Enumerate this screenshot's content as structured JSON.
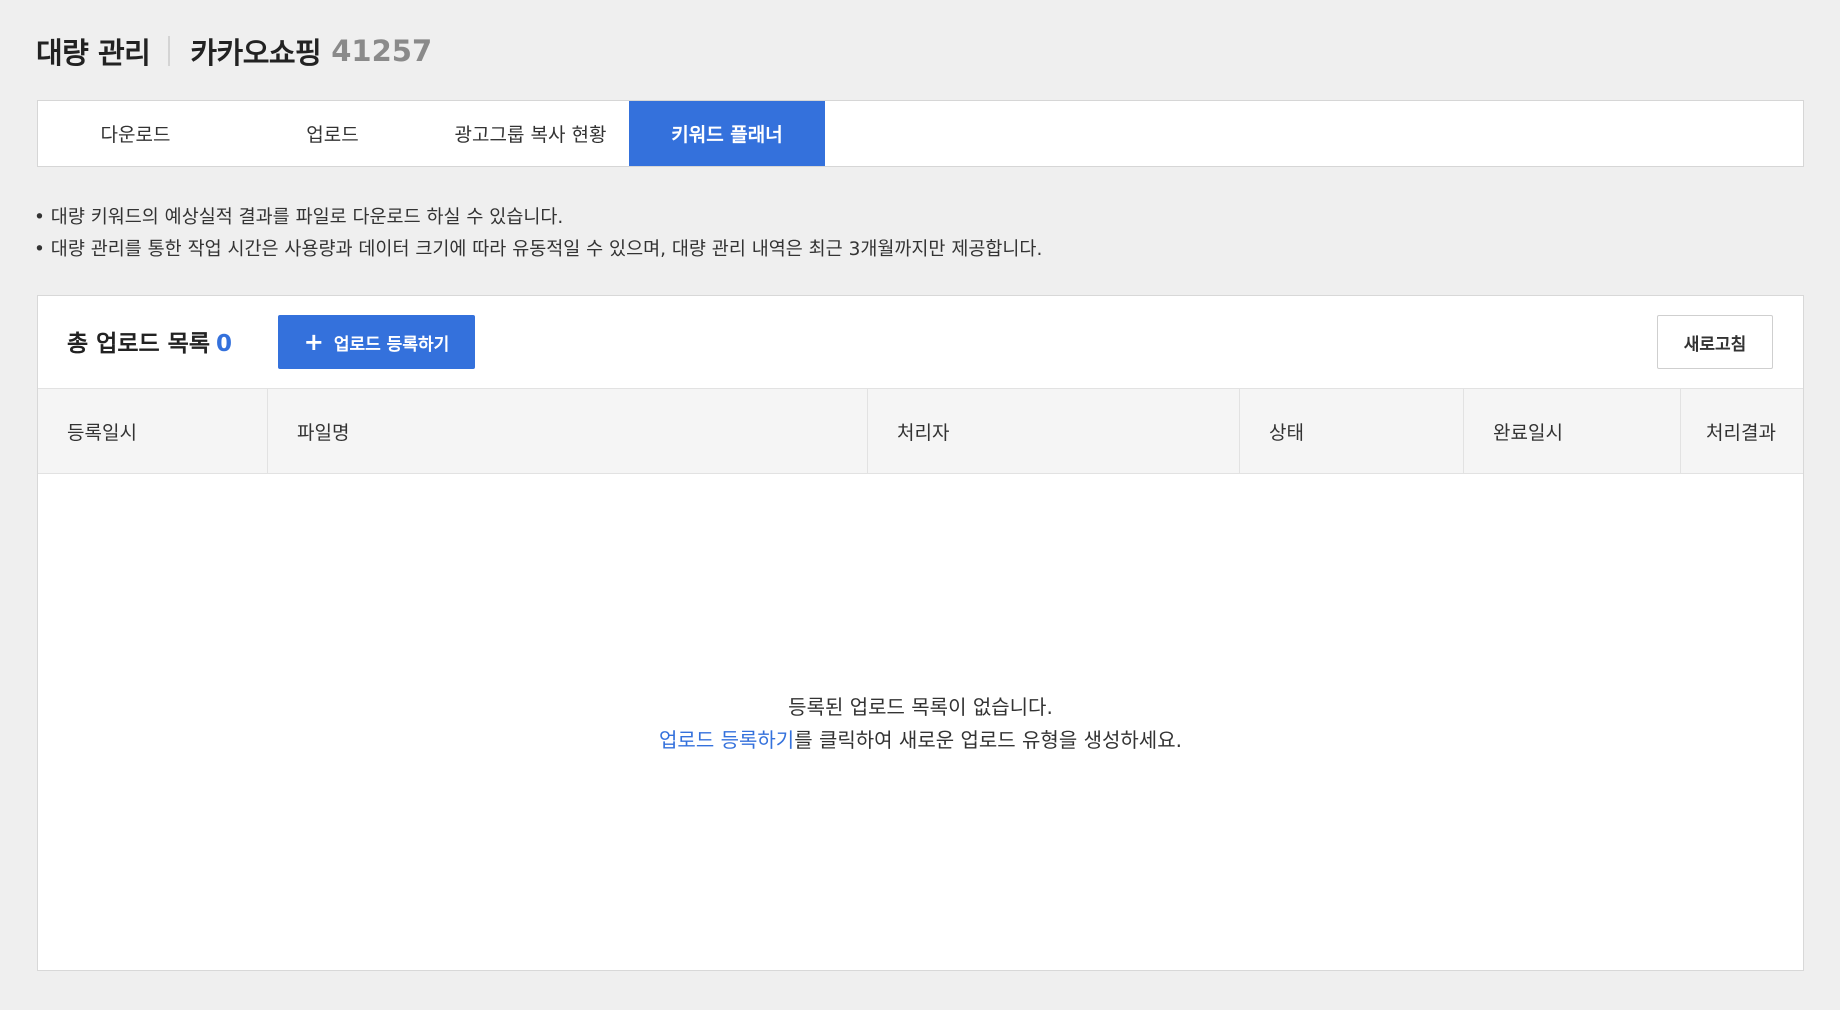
{
  "header": {
    "title": "대량 관리",
    "account_name": "카카오쇼핑",
    "account_id": "41257"
  },
  "tabs": [
    {
      "label": "다운로드",
      "active": false
    },
    {
      "label": "업로드",
      "active": false
    },
    {
      "label": "광고그룹 복사 현황",
      "active": false
    },
    {
      "label": "키워드 플래너",
      "active": true
    }
  ],
  "notices": [
    "• 대량 키워드의 예상실적 결과를 파일로 다운로드 하실 수 있습니다.",
    "• 대량 관리를 통한 작업 시간은 사용량과 데이터 크기에 따라 유동적일 수 있으며, 대량 관리 내역은 최근 3개월까지만 제공합니다."
  ],
  "panel": {
    "total_label": "총 업로드 목록",
    "total_count": "0",
    "register_button": "업로드 등록하기",
    "refresh_button": "새로고침",
    "columns": [
      "등록일시",
      "파일명",
      "처리자",
      "상태",
      "완료일시",
      "처리결과"
    ],
    "empty_line1": "등록된 업로드 목록이 없습니다.",
    "empty_link": "업로드 등록하기",
    "empty_line2_suffix": "를 클릭하여 새로운 업로드 유형을 생성하세요."
  },
  "colors": {
    "accent": "#3471dc",
    "background": "#efefef",
    "title_id": "#8a8a8a"
  },
  "icons": {
    "register_button_icon": "plus-icon"
  }
}
